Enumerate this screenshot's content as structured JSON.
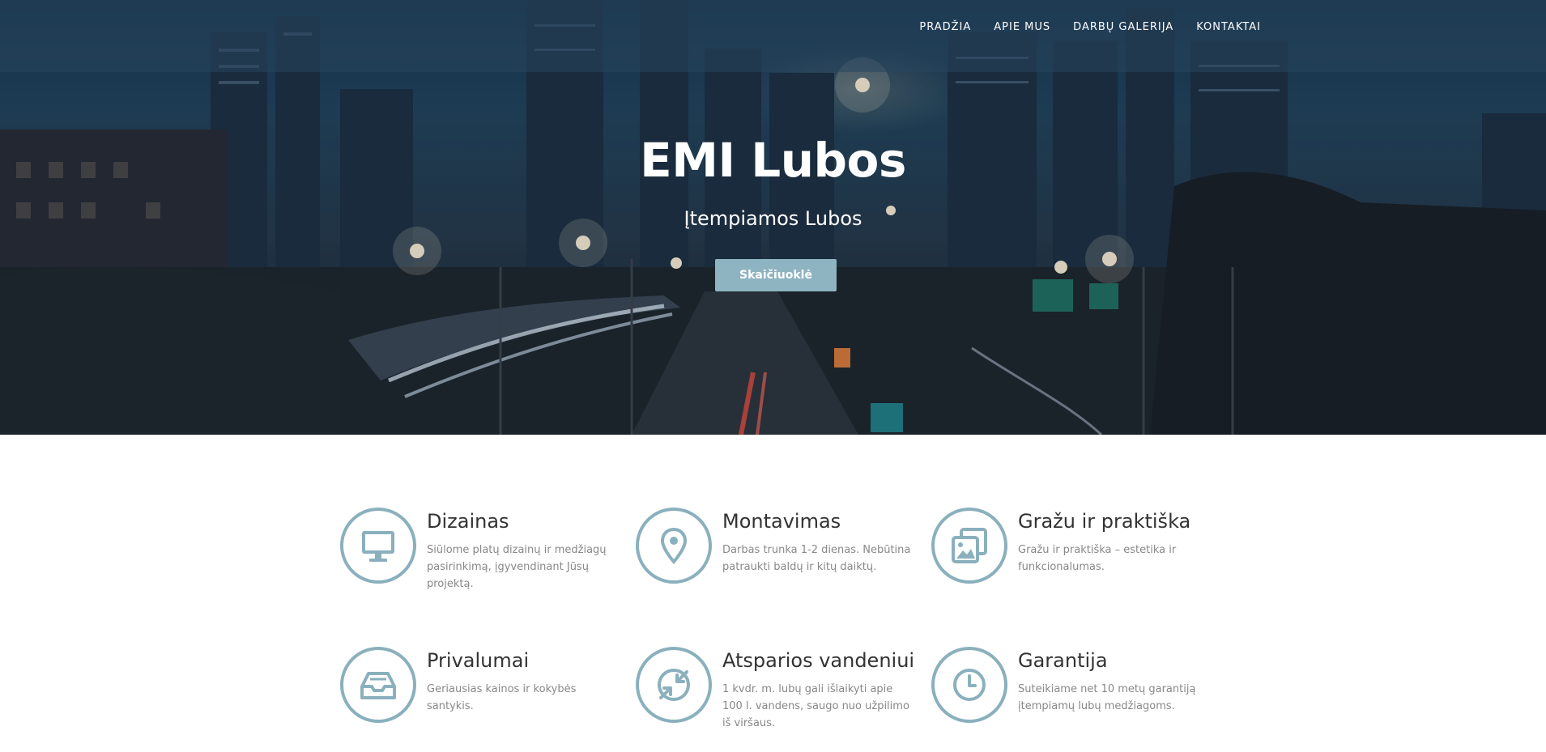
{
  "colors": {
    "accent": "#8fb4c1",
    "icon_stroke": "#8ab0bd",
    "title_text": "#333333",
    "body_text": "#888888"
  },
  "nav": {
    "items": [
      {
        "label": "PRADŽIA"
      },
      {
        "label": "APIE MUS"
      },
      {
        "label": "DARBŲ GALERIJA"
      },
      {
        "label": "KONTAKTAI"
      }
    ]
  },
  "hero": {
    "title": "EMI Lubos",
    "subtitle": "Įtempiamos Lubos",
    "button_label": "Skaičiuoklė"
  },
  "features": [
    {
      "icon": "monitor-icon",
      "title": "Dizainas",
      "text": "Siūlome platų dizainų ir medžiagų pasirinkimą, įgyvendinant Jūsų projektą."
    },
    {
      "icon": "map-pin-icon",
      "title": "Montavimas",
      "text": "Darbas trunka 1-2 dienas. Nebūtina patraukti baldų ir kitų daiktų."
    },
    {
      "icon": "images-icon",
      "title": "Gražu ir praktiška",
      "text": "Gražu ir praktiška – estetika ir funkcionalumas."
    },
    {
      "icon": "inbox-tray-icon",
      "title": "Privalumai",
      "text": "Geriausias kainos ir kokybės santykis."
    },
    {
      "icon": "compress-arrows-icon",
      "title": "Atsparios vandeniui",
      "text": "1 kvdr. m. lubų gali išlaikyti apie 100 l. vandens, saugo nuo užpilimo iš viršaus."
    },
    {
      "icon": "clock-icon",
      "title": "Garantija",
      "text": "Suteikiame net 10 metų garantiją įtempiamų lubų medžiagoms."
    }
  ]
}
